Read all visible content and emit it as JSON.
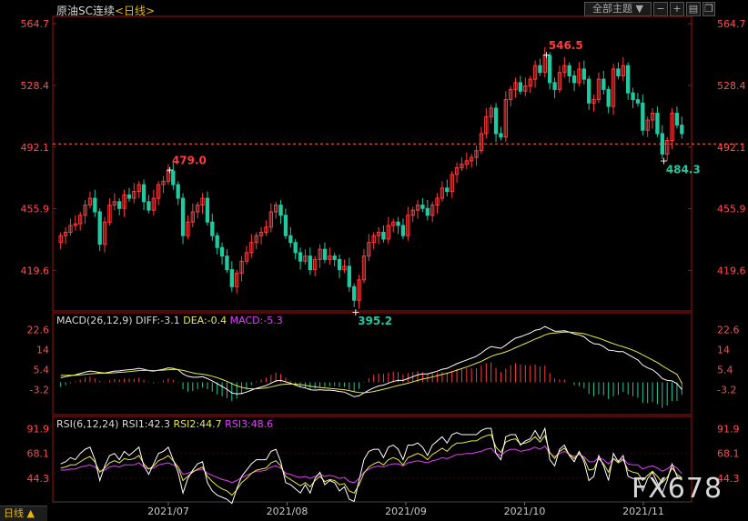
{
  "header": {
    "instrument": "原油SC连续",
    "period": "<日线>",
    "theme_button": "全部主题",
    "theme_arrow": "▼"
  },
  "colors": {
    "up": "#ff3b3b",
    "down": "#20c9a0",
    "diff": "#ffffff",
    "dea": "#e8e84a",
    "macd_label": "#e040fb",
    "rsi1": "#ffffff",
    "rsi2": "#e8e84a",
    "rsi3": "#e040fb",
    "axis_text": "#ff4d4d",
    "grid": "#a01010"
  },
  "chart_data": [
    {
      "type": "candlestick",
      "title": "原油SC连续",
      "y_ticks": [
        564.7,
        528.4,
        492.1,
        455.9,
        419.6
      ],
      "ylim": [
        400.0,
        564.7
      ],
      "x_ticks": [
        "2021/07",
        "2021/08",
        "2021/09",
        "2021/10",
        "2021/11"
      ],
      "reference_line": 494.0,
      "annotations": [
        {
          "label": "479.0",
          "value": 479.0
        },
        {
          "label": "395.2",
          "value": 395.2
        },
        {
          "label": "546.5",
          "value": 546.5
        },
        {
          "label": "484.3",
          "value": 484.3
        }
      ],
      "closes": [
        440,
        442,
        446,
        447,
        452,
        458,
        462,
        454,
        435,
        448,
        458,
        460,
        456,
        464,
        462,
        466,
        470,
        460,
        455,
        462,
        470,
        472,
        478,
        470,
        462,
        440,
        448,
        454,
        458,
        462,
        448,
        440,
        433,
        428,
        420,
        410,
        418,
        425,
        430,
        436,
        440,
        442,
        445,
        454,
        458,
        452,
        440,
        436,
        430,
        425,
        428,
        420,
        426,
        432,
        426,
        428,
        426,
        420,
        422,
        410,
        402,
        414,
        428,
        436,
        440,
        442,
        438,
        446,
        448,
        446,
        440,
        452,
        455,
        458,
        456,
        452,
        458,
        462,
        468,
        466,
        476,
        480,
        482,
        484,
        486,
        490,
        500,
        510,
        515,
        500,
        498,
        520,
        526,
        530,
        525,
        528,
        532,
        540,
        536,
        546,
        530,
        526,
        536,
        540,
        534,
        530,
        538,
        532,
        518,
        520,
        532,
        526,
        516,
        538,
        534,
        540,
        524,
        520,
        518,
        502,
        508,
        512,
        500,
        488,
        496,
        512,
        505,
        500
      ],
      "opens": [
        436,
        440,
        442,
        446,
        447,
        452,
        458,
        462,
        454,
        435,
        448,
        458,
        460,
        456,
        464,
        462,
        466,
        470,
        460,
        455,
        462,
        470,
        472,
        478,
        470,
        462,
        440,
        448,
        454,
        458,
        462,
        448,
        440,
        433,
        428,
        420,
        410,
        418,
        425,
        430,
        436,
        440,
        442,
        445,
        454,
        458,
        452,
        440,
        436,
        430,
        425,
        428,
        420,
        426,
        432,
        426,
        428,
        426,
        420,
        422,
        410,
        402,
        414,
        428,
        436,
        440,
        442,
        438,
        446,
        448,
        446,
        440,
        452,
        455,
        458,
        456,
        452,
        458,
        462,
        468,
        466,
        476,
        480,
        482,
        484,
        486,
        490,
        500,
        510,
        515,
        500,
        498,
        520,
        526,
        530,
        525,
        528,
        532,
        540,
        536,
        546,
        530,
        526,
        536,
        540,
        534,
        530,
        538,
        532,
        518,
        520,
        532,
        526,
        516,
        538,
        534,
        540,
        524,
        520,
        518,
        502,
        508,
        512,
        500,
        488,
        496,
        512,
        505
      ]
    },
    {
      "type": "line",
      "title": "MACD(26,12,9)",
      "y_ticks": [
        22.6,
        14.0,
        5.4,
        -3.2
      ],
      "ylim": [
        -10.0,
        26.0
      ],
      "legend": [
        {
          "label": "MACD(26,12,9)",
          "key": "name"
        },
        {
          "label": "DIFF:-3.1",
          "key": "diff"
        },
        {
          "label": "DEA:-0.4",
          "key": "dea"
        },
        {
          "label": "MACD:-5.3",
          "key": "macd"
        }
      ],
      "diff": [
        2,
        2.4,
        2.8,
        3.2,
        3.8,
        4.4,
        4.8,
        4.6,
        4.2,
        4.0,
        4.4,
        4.8,
        4.9,
        5.2,
        5.4,
        5.6,
        6.0,
        5.6,
        5.0,
        4.8,
        5.2,
        5.6,
        6.2,
        6.0,
        5.4,
        3.6,
        2.6,
        2.2,
        2.2,
        2.4,
        1.6,
        0.6,
        -0.6,
        -1.8,
        -3.0,
        -4.6,
        -5.0,
        -4.8,
        -4.2,
        -3.4,
        -2.6,
        -2.0,
        -1.4,
        -0.4,
        0.6,
        0.8,
        0.2,
        -0.4,
        -1.2,
        -2.0,
        -2.4,
        -3.2,
        -3.4,
        -3.2,
        -3.4,
        -3.4,
        -3.6,
        -4.0,
        -4.2,
        -5.2,
        -6.2,
        -5.8,
        -4.6,
        -3.4,
        -2.4,
        -1.6,
        -1.2,
        -0.4,
        0.4,
        0.8,
        0.8,
        1.6,
        2.4,
        3.2,
        3.6,
        3.6,
        4.2,
        4.8,
        5.6,
        6.0,
        7.0,
        8.0,
        8.8,
        9.6,
        10.4,
        11.2,
        12.6,
        14.2,
        15.4,
        15.0,
        14.6,
        16.0,
        17.6,
        19.0,
        19.6,
        20.4,
        21.2,
        22.4,
        22.8,
        24.0,
        23.0,
        22.0,
        22.0,
        22.2,
        21.6,
        20.8,
        20.4,
        19.6,
        17.8,
        16.6,
        16.4,
        15.4,
        13.8,
        13.6,
        13.2,
        13.2,
        12.0,
        10.8,
        9.6,
        7.4,
        6.2,
        5.4,
        3.8,
        1.6,
        0.8,
        0.6,
        -0.6,
        -3.1
      ],
      "dea": [
        3.0,
        3.0,
        3.0,
        3.0,
        3.2,
        3.4,
        3.6,
        3.8,
        3.9,
        3.9,
        4.0,
        4.1,
        4.3,
        4.4,
        4.6,
        4.8,
        5.0,
        5.1,
        5.1,
        5.0,
        5.1,
        5.2,
        5.4,
        5.5,
        5.5,
        5.1,
        4.6,
        4.1,
        3.7,
        3.5,
        3.1,
        2.6,
        2.0,
        1.2,
        0.4,
        -0.6,
        -1.5,
        -2.2,
        -2.6,
        -2.8,
        -2.8,
        -2.6,
        -2.4,
        -2.0,
        -1.5,
        -1.0,
        -0.8,
        -0.7,
        -0.8,
        -1.0,
        -1.3,
        -1.7,
        -2.0,
        -2.2,
        -2.4,
        -2.6,
        -2.8,
        -3.0,
        -3.2,
        -3.6,
        -4.1,
        -4.4,
        -4.5,
        -4.3,
        -4.0,
        -3.5,
        -3.0,
        -2.5,
        -1.9,
        -1.4,
        -0.9,
        -0.4,
        0.2,
        0.8,
        1.4,
        1.8,
        2.3,
        2.8,
        3.4,
        3.9,
        4.5,
        5.2,
        5.9,
        6.6,
        7.4,
        8.2,
        9.0,
        10.1,
        11.1,
        11.9,
        12.4,
        13.1,
        13.9,
        14.9,
        15.8,
        16.7,
        17.6,
        18.6,
        19.4,
        20.4,
        21.0,
        21.2,
        21.4,
        21.6,
        21.6,
        21.4,
        21.2,
        20.9,
        20.3,
        19.6,
        19.0,
        18.2,
        17.4,
        16.6,
        15.9,
        15.3,
        14.6,
        13.8,
        12.9,
        11.8,
        10.7,
        9.6,
        8.5,
        7.1,
        5.8,
        4.6,
        3.4,
        -0.4
      ]
    },
    {
      "type": "line",
      "title": "RSI(6,12,24)",
      "y_ticks": [
        91.9,
        68.1,
        44.3
      ],
      "ylim": [
        25.0,
        100.0
      ],
      "legend": [
        {
          "label": "RSI(6,12,24)",
          "key": "name"
        },
        {
          "label": "RSI1:42.3",
          "key": "rsi1"
        },
        {
          "label": "RSI2:44.7",
          "key": "rsi2"
        },
        {
          "label": "RSI3:48.6",
          "key": "rsi3"
        }
      ],
      "rsi1": [
        58,
        60,
        64,
        62,
        68,
        72,
        74,
        62,
        42,
        56,
        66,
        68,
        62,
        70,
        66,
        70,
        74,
        56,
        48,
        58,
        68,
        70,
        74,
        62,
        50,
        30,
        44,
        52,
        58,
        60,
        40,
        32,
        28,
        26,
        24,
        20,
        34,
        46,
        52,
        58,
        62,
        62,
        62,
        70,
        72,
        60,
        40,
        38,
        34,
        30,
        38,
        30,
        44,
        50,
        38,
        42,
        40,
        32,
        36,
        24,
        22,
        42,
        62,
        70,
        72,
        72,
        64,
        74,
        76,
        72,
        62,
        76,
        76,
        78,
        74,
        66,
        76,
        80,
        84,
        78,
        86,
        88,
        86,
        86,
        86,
        86,
        90,
        92,
        92,
        68,
        62,
        84,
        86,
        86,
        76,
        80,
        82,
        90,
        82,
        92,
        62,
        56,
        72,
        76,
        66,
        60,
        70,
        60,
        42,
        46,
        66,
        56,
        42,
        68,
        60,
        66,
        46,
        44,
        44,
        32,
        44,
        50,
        40,
        30,
        42,
        58,
        46,
        42.3
      ],
      "rsi2": [
        54,
        55,
        57,
        57,
        60,
        63,
        65,
        60,
        50,
        54,
        59,
        61,
        59,
        63,
        62,
        63,
        66,
        58,
        53,
        56,
        61,
        63,
        66,
        61,
        55,
        42,
        46,
        50,
        53,
        55,
        46,
        41,
        37,
        34,
        32,
        28,
        33,
        40,
        44,
        49,
        52,
        53,
        54,
        59,
        61,
        56,
        46,
        43,
        40,
        37,
        40,
        36,
        42,
        46,
        41,
        43,
        42,
        38,
        39,
        32,
        30,
        38,
        49,
        55,
        58,
        60,
        57,
        62,
        64,
        62,
        57,
        64,
        66,
        68,
        66,
        62,
        67,
        70,
        73,
        70,
        75,
        78,
        78,
        79,
        80,
        80,
        83,
        85,
        86,
        74,
        69,
        79,
        81,
        82,
        77,
        78,
        80,
        84,
        79,
        85,
        69,
        63,
        70,
        73,
        67,
        63,
        68,
        63,
        52,
        53,
        63,
        58,
        50,
        63,
        59,
        62,
        52,
        50,
        49,
        42,
        47,
        51,
        46,
        40,
        45,
        54,
        48,
        44.7
      ],
      "rsi3": [
        52,
        52,
        53,
        53,
        55,
        56,
        57,
        55,
        51,
        52,
        55,
        56,
        55,
        57,
        57,
        57,
        59,
        55,
        53,
        54,
        57,
        58,
        59,
        57,
        55,
        48,
        49,
        51,
        52,
        53,
        49,
        47,
        45,
        43,
        42,
        40,
        42,
        45,
        47,
        49,
        51,
        51,
        52,
        55,
        56,
        54,
        49,
        48,
        46,
        45,
        46,
        44,
        46,
        48,
        46,
        47,
        46,
        44,
        45,
        41,
        40,
        44,
        50,
        53,
        55,
        56,
        55,
        57,
        58,
        58,
        56,
        59,
        60,
        61,
        60,
        59,
        61,
        62,
        64,
        63,
        65,
        67,
        67,
        68,
        68,
        69,
        70,
        72,
        73,
        68,
        66,
        70,
        72,
        72,
        70,
        71,
        72,
        74,
        72,
        75,
        68,
        65,
        68,
        70,
        67,
        65,
        67,
        65,
        60,
        60,
        64,
        62,
        58,
        63,
        61,
        63,
        58,
        57,
        57,
        53,
        55,
        56,
        54,
        51,
        53,
        57,
        54,
        48.6
      ]
    }
  ],
  "bottom": {
    "tab_label": "日线",
    "tab_arrow": "▲"
  },
  "watermark": "FX678"
}
